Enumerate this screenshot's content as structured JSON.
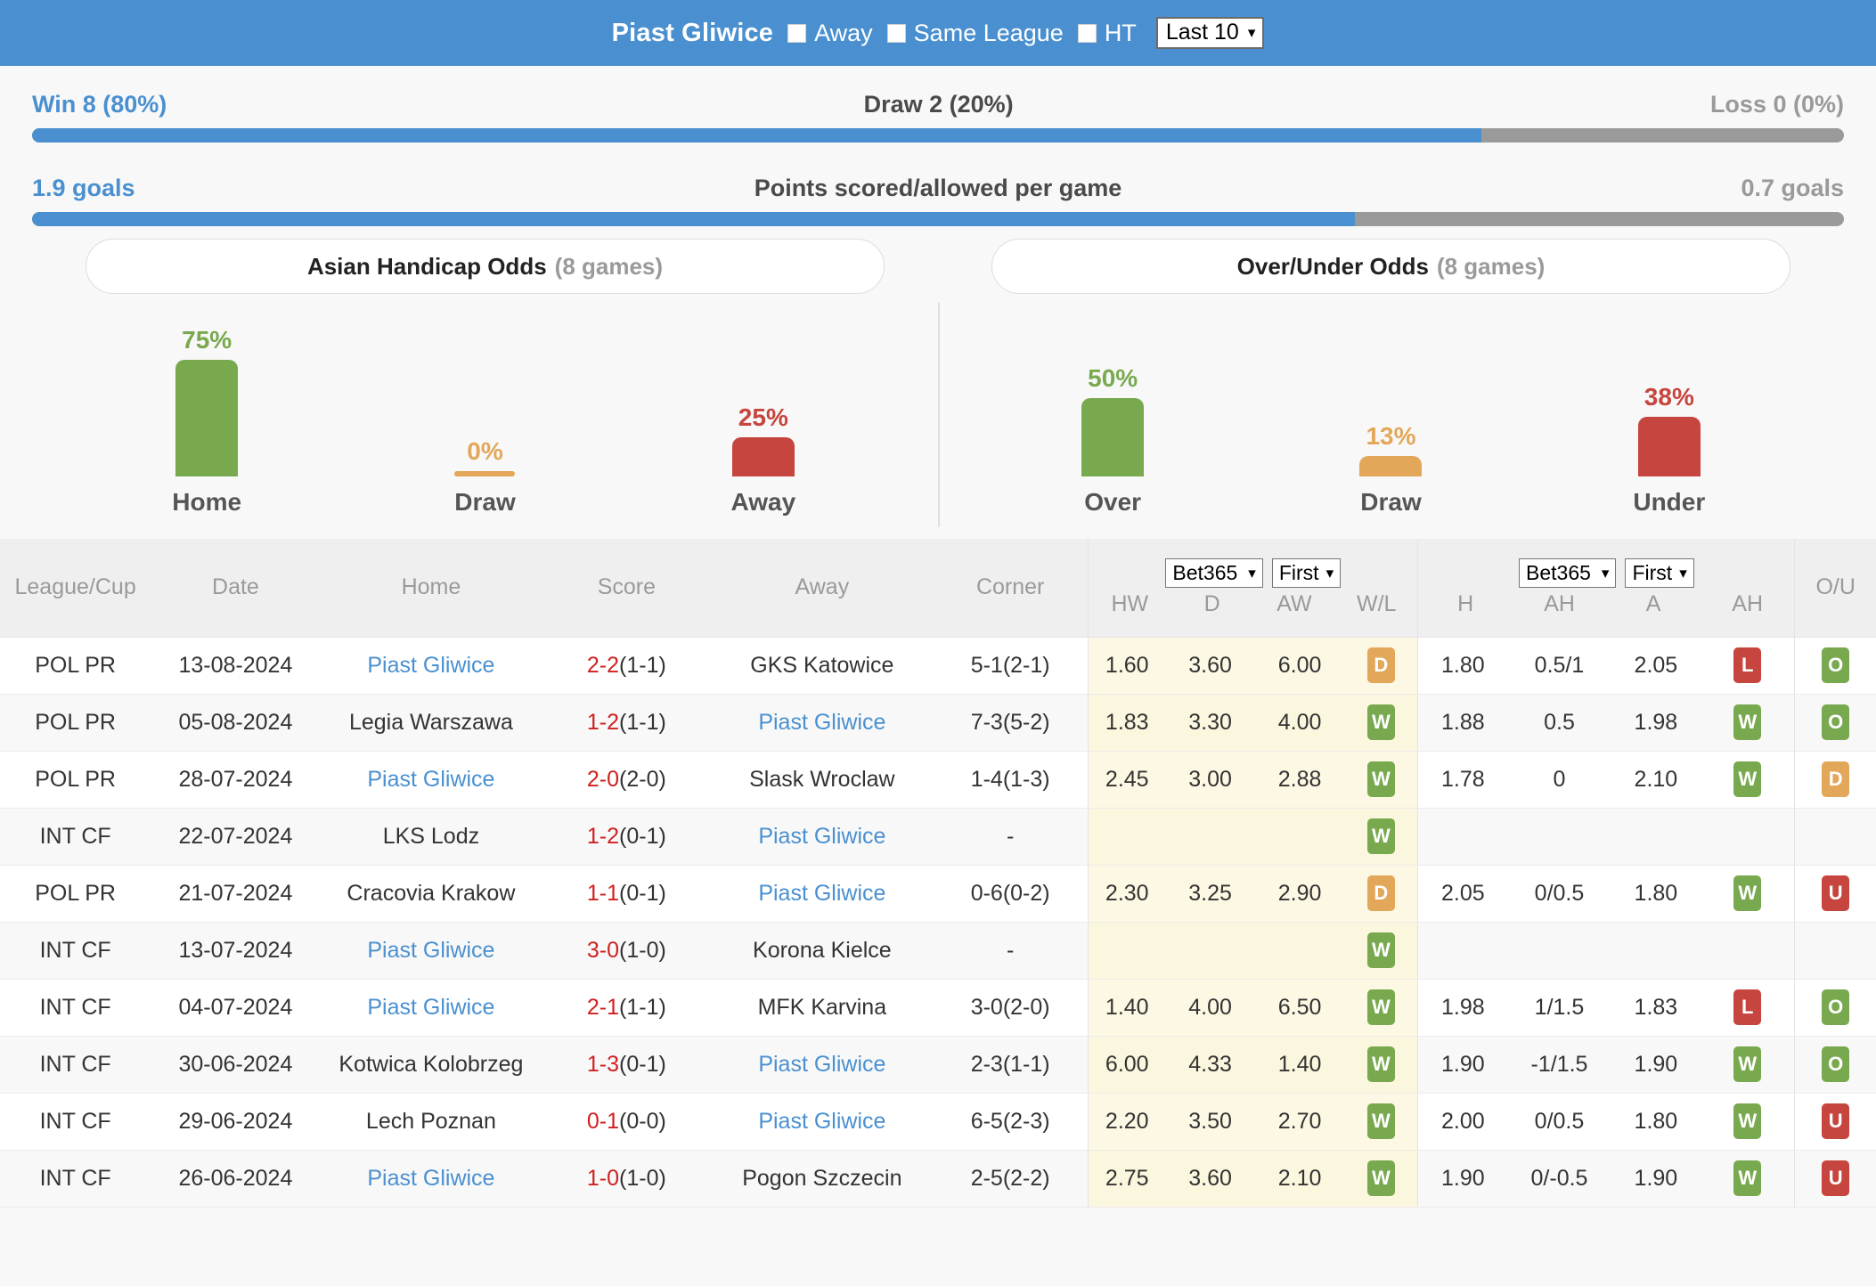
{
  "header": {
    "team": "Piast Gliwice",
    "checkboxes": [
      {
        "label": "Away",
        "checked": false
      },
      {
        "label": "Same League",
        "checked": false
      },
      {
        "label": "HT",
        "checked": false
      }
    ],
    "range_select": {
      "value": "Last 10",
      "caret": "chevron-down-icon"
    }
  },
  "summary": {
    "wdl": {
      "win_label": "Win 8 (80%)",
      "draw_label": "Draw 2 (20%)",
      "loss_label": "Loss 0 (0%)",
      "win_pct": 80,
      "draw_pct": 20,
      "loss_pct": 0,
      "fill_pct": 80
    },
    "goals": {
      "left_label": "1.9 goals",
      "title": "Points scored/allowed per game",
      "right_label": "0.7 goals",
      "scored": 1.9,
      "allowed": 0.7,
      "fill_pct": 73
    }
  },
  "chart_data": [
    {
      "type": "bar",
      "title": "Asian Handicap Odds",
      "games": "(8 games)",
      "categories": [
        "Home",
        "Draw",
        "Away"
      ],
      "values": [
        75,
        0,
        25
      ],
      "labels": [
        "75%",
        "0%",
        "25%"
      ],
      "colors": [
        "#79a94f",
        "#e3a75a",
        "#c6453e"
      ],
      "ylabel": "",
      "xlabel": "",
      "ylim": [
        0,
        100
      ]
    },
    {
      "type": "bar",
      "title": "Over/Under Odds",
      "games": "(8 games)",
      "categories": [
        "Over",
        "Draw",
        "Under"
      ],
      "values": [
        50,
        13,
        38
      ],
      "labels": [
        "50%",
        "13%",
        "38%"
      ],
      "colors": [
        "#79a94f",
        "#e3a75a",
        "#c6453e"
      ],
      "ylabel": "",
      "xlabel": "",
      "ylim": [
        0,
        100
      ]
    }
  ],
  "table": {
    "columns": [
      "League/Cup",
      "Date",
      "Home",
      "Score",
      "Away",
      "Corner"
    ],
    "group1": {
      "book_select": "Bet365",
      "period_select": "First",
      "subs": [
        "HW",
        "D",
        "AW",
        "W/L"
      ]
    },
    "group2": {
      "book_select": "Bet365",
      "period_select": "First",
      "subs": [
        "H",
        "AH",
        "A",
        "AH"
      ]
    },
    "ou_header": "O/U",
    "rows": [
      {
        "league": "POL PR",
        "date": "13-08-2024",
        "home": "Piast Gliwice",
        "home_link": true,
        "score": "2-2",
        "score_ht": "(1-1)",
        "away": "GKS Katowice",
        "away_link": false,
        "corner": "5-1(2-1)",
        "hw": "1.60",
        "d": "3.60",
        "aw": "6.00",
        "wl": "D",
        "h": "1.80",
        "ah1": "0.5/1",
        "a": "2.05",
        "ah2": "L",
        "ou": "O"
      },
      {
        "league": "POL PR",
        "date": "05-08-2024",
        "home": "Legia Warszawa",
        "home_link": false,
        "score": "1-2",
        "score_ht": "(1-1)",
        "away": "Piast Gliwice",
        "away_link": true,
        "corner": "7-3(5-2)",
        "hw": "1.83",
        "d": "3.30",
        "aw": "4.00",
        "wl": "W",
        "h": "1.88",
        "ah1": "0.5",
        "a": "1.98",
        "ah2": "W",
        "ou": "O"
      },
      {
        "league": "POL PR",
        "date": "28-07-2024",
        "home": "Piast Gliwice",
        "home_link": true,
        "score": "2-0",
        "score_ht": "(2-0)",
        "away": "Slask Wroclaw",
        "away_link": false,
        "corner": "1-4(1-3)",
        "hw": "2.45",
        "d": "3.00",
        "aw": "2.88",
        "wl": "W",
        "h": "1.78",
        "ah1": "0",
        "a": "2.10",
        "ah2": "W",
        "ou": "D"
      },
      {
        "league": "INT CF",
        "date": "22-07-2024",
        "home": "LKS Lodz",
        "home_link": false,
        "score": "1-2",
        "score_ht": "(0-1)",
        "away": "Piast Gliwice",
        "away_link": true,
        "corner": "-",
        "hw": "",
        "d": "",
        "aw": "",
        "wl": "W",
        "h": "",
        "ah1": "",
        "a": "",
        "ah2": "",
        "ou": ""
      },
      {
        "league": "POL PR",
        "date": "21-07-2024",
        "home": "Cracovia Krakow",
        "home_link": false,
        "score": "1-1",
        "score_ht": "(0-1)",
        "away": "Piast Gliwice",
        "away_link": true,
        "corner": "0-6(0-2)",
        "hw": "2.30",
        "d": "3.25",
        "aw": "2.90",
        "wl": "D",
        "h": "2.05",
        "ah1": "0/0.5",
        "a": "1.80",
        "ah2": "W",
        "ou": "U"
      },
      {
        "league": "INT CF",
        "date": "13-07-2024",
        "home": "Piast Gliwice",
        "home_link": true,
        "score": "3-0",
        "score_ht": "(1-0)",
        "away": "Korona Kielce",
        "away_link": false,
        "corner": "-",
        "hw": "",
        "d": "",
        "aw": "",
        "wl": "W",
        "h": "",
        "ah1": "",
        "a": "",
        "ah2": "",
        "ou": ""
      },
      {
        "league": "INT CF",
        "date": "04-07-2024",
        "home": "Piast Gliwice",
        "home_link": true,
        "score": "2-1",
        "score_ht": "(1-1)",
        "away": "MFK Karvina",
        "away_link": false,
        "corner": "3-0(2-0)",
        "hw": "1.40",
        "d": "4.00",
        "aw": "6.50",
        "wl": "W",
        "h": "1.98",
        "ah1": "1/1.5",
        "a": "1.83",
        "ah2": "L",
        "ou": "O"
      },
      {
        "league": "INT CF",
        "date": "30-06-2024",
        "home": "Kotwica Kolobrzeg",
        "home_link": false,
        "score": "1-3",
        "score_ht": "(0-1)",
        "away": "Piast Gliwice",
        "away_link": true,
        "corner": "2-3(1-1)",
        "hw": "6.00",
        "d": "4.33",
        "aw": "1.40",
        "wl": "W",
        "h": "1.90",
        "ah1": "-1/1.5",
        "a": "1.90",
        "ah2": "W",
        "ou": "O"
      },
      {
        "league": "INT CF",
        "date": "29-06-2024",
        "home": "Lech Poznan",
        "home_link": false,
        "score": "0-1",
        "score_ht": "(0-0)",
        "away": "Piast Gliwice",
        "away_link": true,
        "corner": "6-5(2-3)",
        "hw": "2.20",
        "d": "3.50",
        "aw": "2.70",
        "wl": "W",
        "h": "2.00",
        "ah1": "0/0.5",
        "a": "1.80",
        "ah2": "W",
        "ou": "U"
      },
      {
        "league": "INT CF",
        "date": "26-06-2024",
        "home": "Piast Gliwice",
        "home_link": true,
        "score": "1-0",
        "score_ht": "(1-0)",
        "away": "Pogon Szczecin",
        "away_link": false,
        "corner": "2-5(2-2)",
        "hw": "2.75",
        "d": "3.60",
        "aw": "2.10",
        "wl": "W",
        "h": "1.90",
        "ah1": "0/-0.5",
        "a": "1.90",
        "ah2": "W",
        "ou": "U"
      }
    ]
  },
  "colors": {
    "accent_blue": "#4a90d0",
    "grey": "#9a9a9a",
    "green": "#79a94f",
    "orange": "#e3a75a",
    "red": "#c6453e",
    "odds_zone": "#fdf8e3"
  }
}
